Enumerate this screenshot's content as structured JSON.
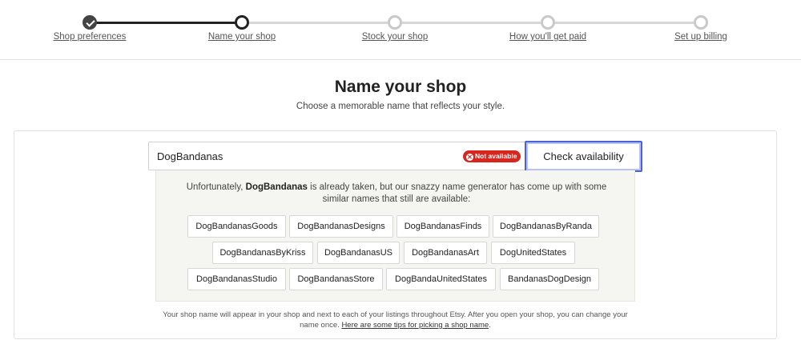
{
  "stepper": {
    "steps": [
      {
        "label": "Shop preferences",
        "state": "done"
      },
      {
        "label": "Name your shop",
        "state": "current"
      },
      {
        "label": "Stock your shop",
        "state": "upcoming"
      },
      {
        "label": "How you'll get paid",
        "state": "upcoming"
      },
      {
        "label": "Set up billing",
        "state": "upcoming"
      }
    ]
  },
  "header": {
    "title": "Name your shop",
    "subtitle": "Choose a memorable name that reflects your style."
  },
  "name_form": {
    "value": "DogBandanas",
    "status_badge": "Not available",
    "check_button": "Check availability"
  },
  "suggestions": {
    "message_prefix": "Unfortunately, ",
    "message_name": "DogBandanas",
    "message_suffix": " is already taken, but our snazzy name generator has come up with some similar names that still are available:",
    "items": [
      "DogBandanasGoods",
      "DogBandanasDesigns",
      "DogBandanasFinds",
      "DogBandanasByRanda",
      "DogBandanasByKriss",
      "DogBandanasUS",
      "DogBandanasArt",
      "DogUnitedStates",
      "DogBandanasStudio",
      "DogBandanasStore",
      "DogBandaUnitedStates",
      "BandanasDogDesign"
    ]
  },
  "footnote": {
    "text": "Your shop name will appear in your shop and next to each of your listings throughout Etsy. After you open your shop, you can change your name once. ",
    "link": "Here are some tips for picking a shop name",
    "end": "."
  },
  "colors": {
    "accent_focus": "#4a62d6",
    "error_badge": "#d7261e",
    "panel_bg": "#f5f5f1"
  }
}
